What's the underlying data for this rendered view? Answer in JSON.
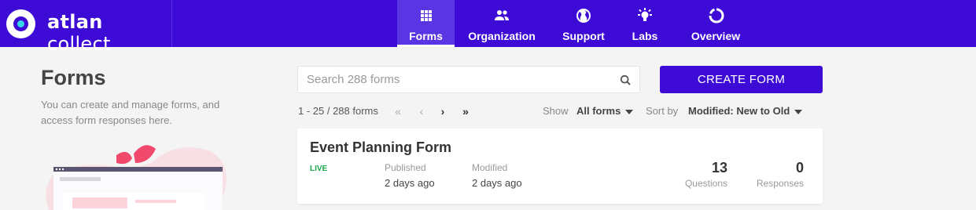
{
  "header": {
    "brand": {
      "bold": "atlan",
      "rest": " collect"
    },
    "nav": [
      {
        "label": "Forms",
        "icon": "grid-icon",
        "active": true
      },
      {
        "label": "Organization",
        "icon": "people-icon"
      },
      {
        "label": "Support",
        "icon": "globe-icon"
      },
      {
        "label": "Labs",
        "icon": "lightbulb-icon"
      },
      {
        "label": "Overview",
        "icon": "ring-chart-icon"
      }
    ]
  },
  "sidebar": {
    "title": "Forms",
    "description": "You can create and manage forms, and access form responses here."
  },
  "search": {
    "placeholder": "Search 288 forms",
    "value": ""
  },
  "create_button": "CREATE FORM",
  "pagination": {
    "range": "1 - 25 / 288 forms"
  },
  "filters": {
    "show_label": "Show",
    "show_value": "All forms",
    "sort_label": "Sort by",
    "sort_value": "Modified: New to Old"
  },
  "forms": [
    {
      "title": "Event Planning Form",
      "status": "LIVE",
      "published_label": "Published",
      "published": "2 days ago",
      "modified_label": "Modified",
      "modified": "2 days ago",
      "questions": "13",
      "questions_label": "Questions",
      "responses": "0",
      "responses_label": "Responses"
    }
  ],
  "colors": {
    "brand": "#3d0ad6",
    "live": "#1aa84a"
  }
}
